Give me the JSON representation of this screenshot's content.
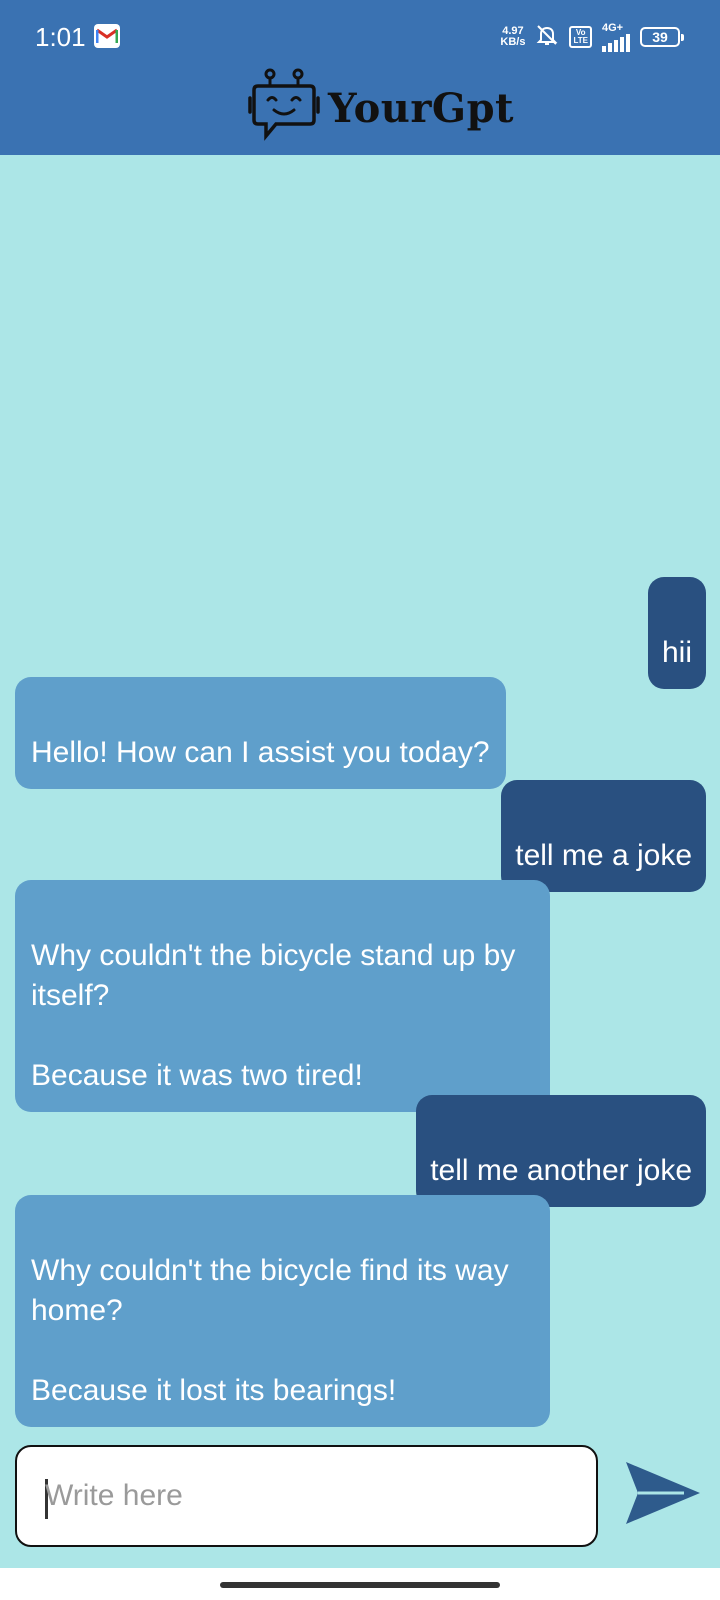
{
  "status_bar": {
    "time": "1:01",
    "net_speed_value": "4.97",
    "net_speed_unit": "KB/s",
    "volte": "Vo LTE",
    "network": "4G+",
    "battery": "39"
  },
  "header": {
    "title": "YourGpt",
    "background": "#3a72b2"
  },
  "chat": {
    "background": "#ace6e7",
    "user_bubble_color": "#295080",
    "bot_bubble_color": "#5f9fcb",
    "messages": [
      {
        "sender": "user",
        "text": "hii"
      },
      {
        "sender": "bot",
        "text": "Hello! How can I assist you today?"
      },
      {
        "sender": "user",
        "text": "tell me a joke"
      },
      {
        "sender": "bot",
        "text": "Why couldn't the bicycle stand up by itself?\n\nBecause it was two tired!"
      },
      {
        "sender": "user",
        "text": "tell me another joke"
      },
      {
        "sender": "bot",
        "text": "Why couldn't the bicycle find its way home?\n\nBecause it lost its bearings!"
      }
    ]
  },
  "composer": {
    "value": "",
    "placeholder": "Write here",
    "send_icon": "send-icon"
  }
}
